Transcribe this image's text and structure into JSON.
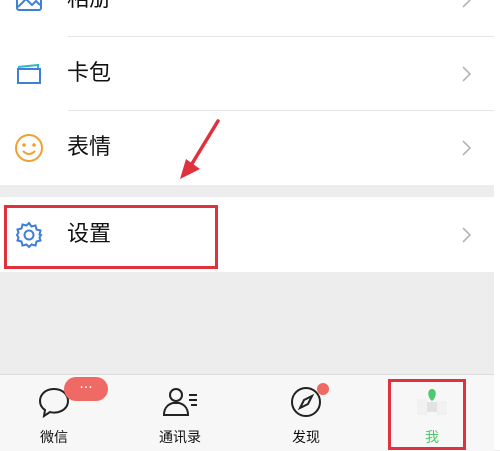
{
  "menu": {
    "album_label": "相册",
    "cards_label": "卡包",
    "stickers_label": "表情",
    "settings_label": "设置"
  },
  "tabbar": {
    "chats_label": "微信",
    "chats_badge": "···",
    "contacts_label": "通讯录",
    "discover_label": "发现",
    "me_label": "我"
  },
  "colors": {
    "accent_green": "#4fc86f",
    "annotation_red": "#e0313d",
    "badge_red": "#ef6a64",
    "icon_blue": "#3f7fd8",
    "icon_orange": "#f0a030"
  }
}
